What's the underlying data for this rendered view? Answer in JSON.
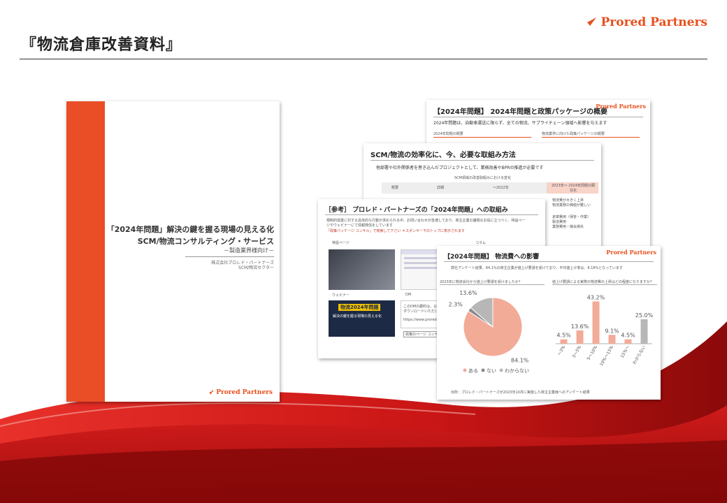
{
  "header": {
    "title": "『物流倉庫改善資料』",
    "brand": "Prored Partners"
  },
  "cover": {
    "line1": "「2024年問題」解決の鍵を握る現場の見える化",
    "line2": "SCM/物流コンサルティング・サービス",
    "line3": "－製造業界様向け－",
    "line4": "株式会社プロレド・パートナーズ",
    "line5": "SCM/物流セクター",
    "brand": "Prored Partners"
  },
  "slide_overview": {
    "title": "【2024年問題】 2024年問題と政策パッケージの概要",
    "brand": "Prored Partners",
    "lead": "2024年問題は、自動車運送に限らず、全ての物流、サプライチェーン領域へ影響を与えます",
    "col_left": "2024年問題の概要",
    "col_right": "物流業界に向けた政策パッケージの概要"
  },
  "slide_method": {
    "title": "SCM/物流の効率化に、今、必要な取組み方法",
    "lead": "他部署や社外関係者を巻き込んだプロジェクトとして、業務改善やBPRの推進が必要です",
    "table_caption": "SCM領域の改善取組みにおける変化",
    "col_overview": "概要",
    "col_detail": "詳細",
    "col_before": "～2022年",
    "col_after": "2023年～ 2024年問題の顕在化",
    "row1": "物流費が大きく上昇",
    "row2": "物流業務の価値が難しい",
    "row3": "倉庫費用（保管・作業）",
    "row4": "製造費用",
    "row5": "業務費用・機会損失"
  },
  "slide_initiatives": {
    "title": "［参考］ プロレド・パートナーズの「2024年問題」への取組み",
    "lead1": "規制的措置に対する具体的な行動が求められる中、お問い合わせが急増しており、荷主企業の課題のお役に立つべく、特設ペー",
    "lead2": "ジやウェビナーにて情報発信をしています",
    "lead3": "「政策パッケージ コンサル」で検索して下さい ＊スポンサー下のトップに表示されます",
    "label_page": "特設ページ",
    "label_column": "コラム",
    "label_webinar": "ウェビナー",
    "label_dm": "DM",
    "banner_title": "物流2024年問題",
    "banner_sub": "解決の鍵を握る現場の見える化",
    "dm_text1": "このDMの趣料は、以",
    "dm_text2": "ダウンロードいただけ",
    "dm_link": "https://www.prored-",
    "dm_button": "政策のページ コンサル"
  },
  "slide_impact": {
    "title": "【2024年問題】 物流費への影響",
    "brand": "Prored Partners",
    "lead": "弊社アンケート結果、84.1%の荷主企業が値上げ要請を受けており、平均値上げ率は、8.18%となっています",
    "pie_caption": "2023年に物流会社から値上げ要請を受けましたか？",
    "bar_caption": "値上げ要請による実際の物流費の上昇はどの程度になりますか？",
    "footnote": "出所：プロレド・パートナーズが2023年10月に実施した荷主企業様へのアンケート結果"
  },
  "chart_data": [
    {
      "type": "pie",
      "title": "2023年に物流会社から値上げ要請を受けましたか？",
      "categories": [
        "ある",
        "ない",
        "わからない"
      ],
      "values": [
        84.1,
        2.3,
        13.6
      ],
      "value_labels": [
        "84.1%",
        "2.3%",
        "13.6%"
      ],
      "colors": [
        "#f2ab97",
        "#8b8b8b",
        "#b7b7b7"
      ]
    },
    {
      "type": "bar",
      "title": "値上げ要請による実際の物流費の上昇はどの程度になりますか？",
      "categories": [
        "～3%",
        "3～5%",
        "5～10%",
        "10%～15%",
        "15%～",
        "わからない"
      ],
      "values": [
        4.5,
        13.6,
        43.2,
        9.1,
        4.5,
        25.0
      ],
      "value_labels": [
        "4.5%",
        "13.6%",
        "43.2%",
        "9.1%",
        "4.5%",
        "25.0%"
      ],
      "colors": [
        "#f2ab97",
        "#f2ab97",
        "#f2ab97",
        "#f2ab97",
        "#f2ab97",
        "#b7b7b7"
      ],
      "ylim": [
        0,
        50
      ]
    }
  ]
}
